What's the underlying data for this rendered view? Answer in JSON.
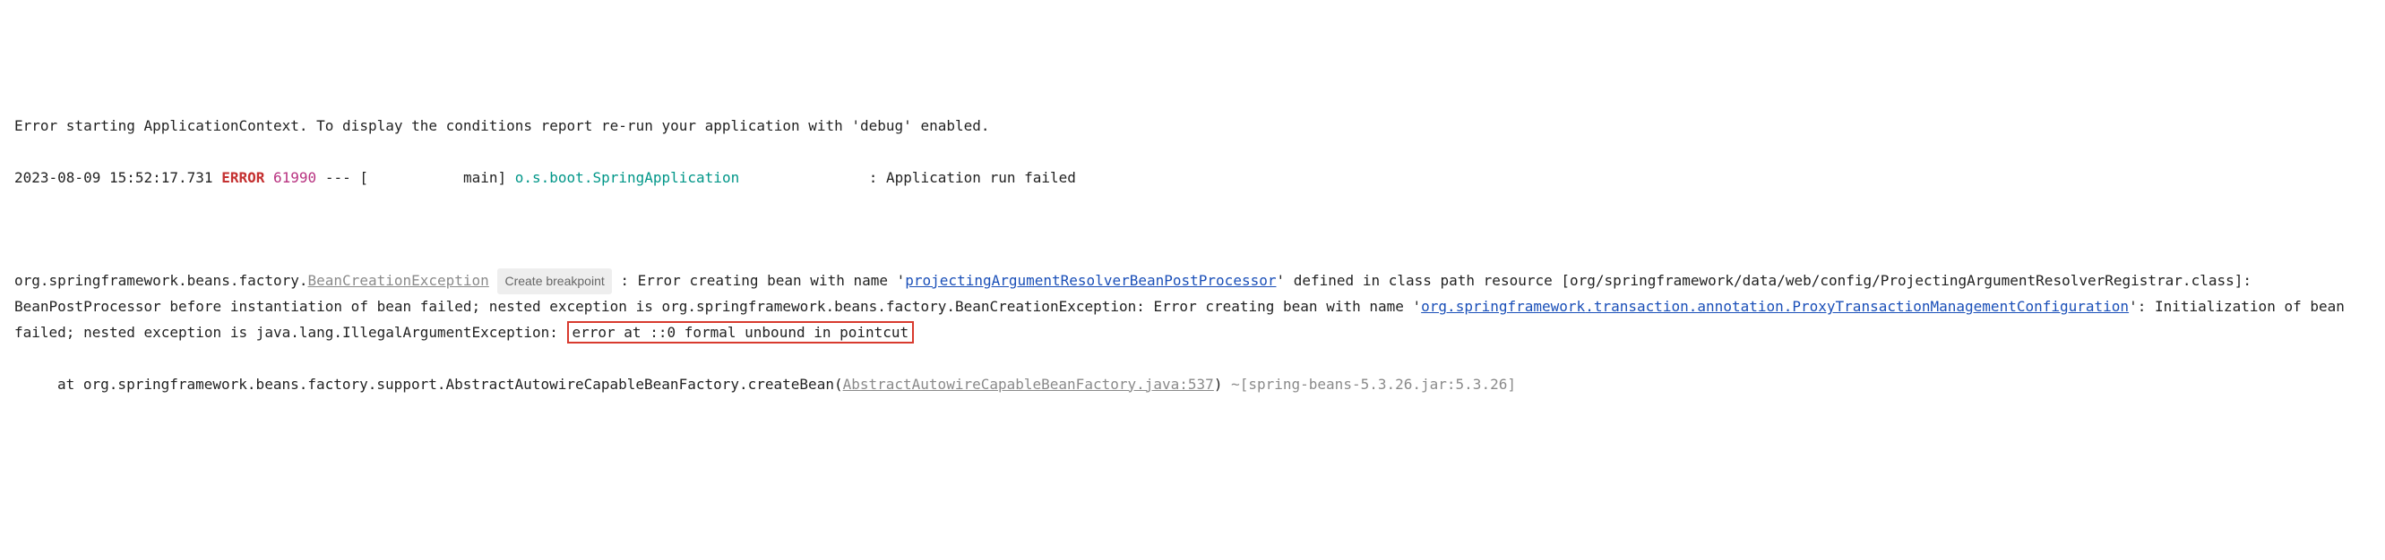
{
  "line1": "Error starting ApplicationContext. To display the conditions report re-run your application with 'debug' enabled.",
  "log": {
    "timestamp": "2023-08-09 15:52:17.731",
    "level": "ERROR",
    "pid": "61990",
    "thread_pre": " --- [           main] ",
    "logger": "o.s.boot.SpringApplication",
    "pad": "               ",
    "message": ": Application run failed"
  },
  "stack": {
    "prefix1": "org.springframework.beans.factory.",
    "exception_link": "BeanCreationException",
    "breakpoint_label": "Create breakpoint",
    "suffix1": " : Error creating bean with name '",
    "bean_link": "projectingArgumentResolverBeanPostProcessor",
    "suffix2": "' defined in class path resource [org/springframework/data/web/config/ProjectingArgumentResolverRegistrar.class]: BeanPostProcessor before instantiation of bean failed; nested exception is org.springframework.beans.factory.BeanCreationException: Error creating bean with name '",
    "nested_link": "org.springframework.beans.factory.transaction.annotation.ProxyTransactionManagementConfiguration",
    "nested_link_display_part1": "org.springframework",
    "nested_link_display_part2": ".transaction.annotation.ProxyTransactionManagementConfiguration",
    "suffix3": "': Initialization of bean failed; nested exception is java.lang.IllegalArgumentException: ",
    "boxed_text": "error at ::0 formal unbound in pointcut"
  },
  "at_line": {
    "prefix": "at org.springframework.beans.factory.support.AbstractAutowireCapableBeanFactory.createBean(",
    "file_link": "AbstractAutowireCapableBeanFactory.java:537",
    "suffix": ")",
    "jar_info": " ~[spring-beans-5.3.26.jar:5.3.26]"
  }
}
